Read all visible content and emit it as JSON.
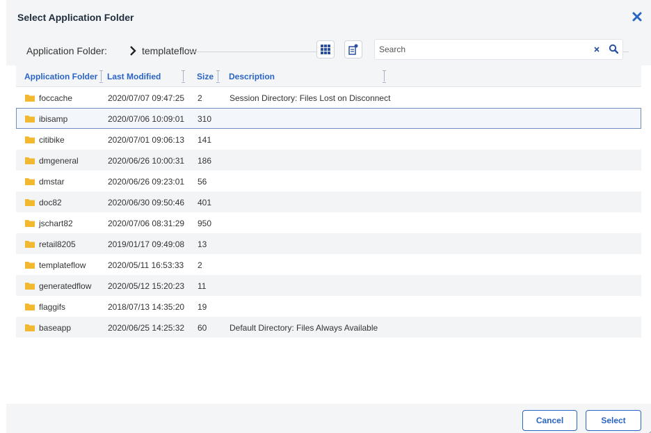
{
  "dialog": {
    "title": "Select Application Folder"
  },
  "breadcrumb": {
    "label": "Application Folder:",
    "current": "templateflow"
  },
  "toolbar": {
    "grid_view_icon": "grid-icon",
    "properties_icon": "properties-icon"
  },
  "search": {
    "placeholder": "Search",
    "value": ""
  },
  "table": {
    "columns": [
      "Application Folder",
      "Last Modified",
      "Size",
      "Description"
    ],
    "rows": [
      {
        "name": "foccache",
        "modified": "2020/07/07 09:47:25",
        "size": "2",
        "description": "Session Directory: Files Lost on Disconnect"
      },
      {
        "name": "ibisamp",
        "modified": "2020/07/06 10:09:01",
        "size": "310",
        "description": ""
      },
      {
        "name": "citibike",
        "modified": "2020/07/01 09:06:13",
        "size": "141",
        "description": ""
      },
      {
        "name": "dmgeneral",
        "modified": "2020/06/26 10:00:31",
        "size": "186",
        "description": ""
      },
      {
        "name": "dmstar",
        "modified": "2020/06/26 09:23:01",
        "size": "56",
        "description": ""
      },
      {
        "name": "doc82",
        "modified": "2020/06/30 09:50:46",
        "size": "401",
        "description": ""
      },
      {
        "name": "jschart82",
        "modified": "2020/07/06 08:31:29",
        "size": "950",
        "description": ""
      },
      {
        "name": "retail8205",
        "modified": "2019/01/17 09:49:08",
        "size": "13",
        "description": ""
      },
      {
        "name": "templateflow",
        "modified": "2020/05/11 16:53:33",
        "size": "2",
        "description": ""
      },
      {
        "name": "generatedflow",
        "modified": "2020/05/12 15:20:23",
        "size": "11",
        "description": ""
      },
      {
        "name": "flaggifs",
        "modified": "2018/07/13 14:35:20",
        "size": "19",
        "description": ""
      },
      {
        "name": "baseapp",
        "modified": "2020/06/25 14:25:32",
        "size": "60",
        "description": "Default Directory: Files Always Available"
      }
    ],
    "selected_row": "ibisamp"
  },
  "footer": {
    "cancel_label": "Cancel",
    "select_label": "Select"
  },
  "colors": {
    "accent": "#2a64c4",
    "folder": "#f2b930",
    "header_bg": "#f4f5f7",
    "selected_border": "#6f8fc4"
  }
}
